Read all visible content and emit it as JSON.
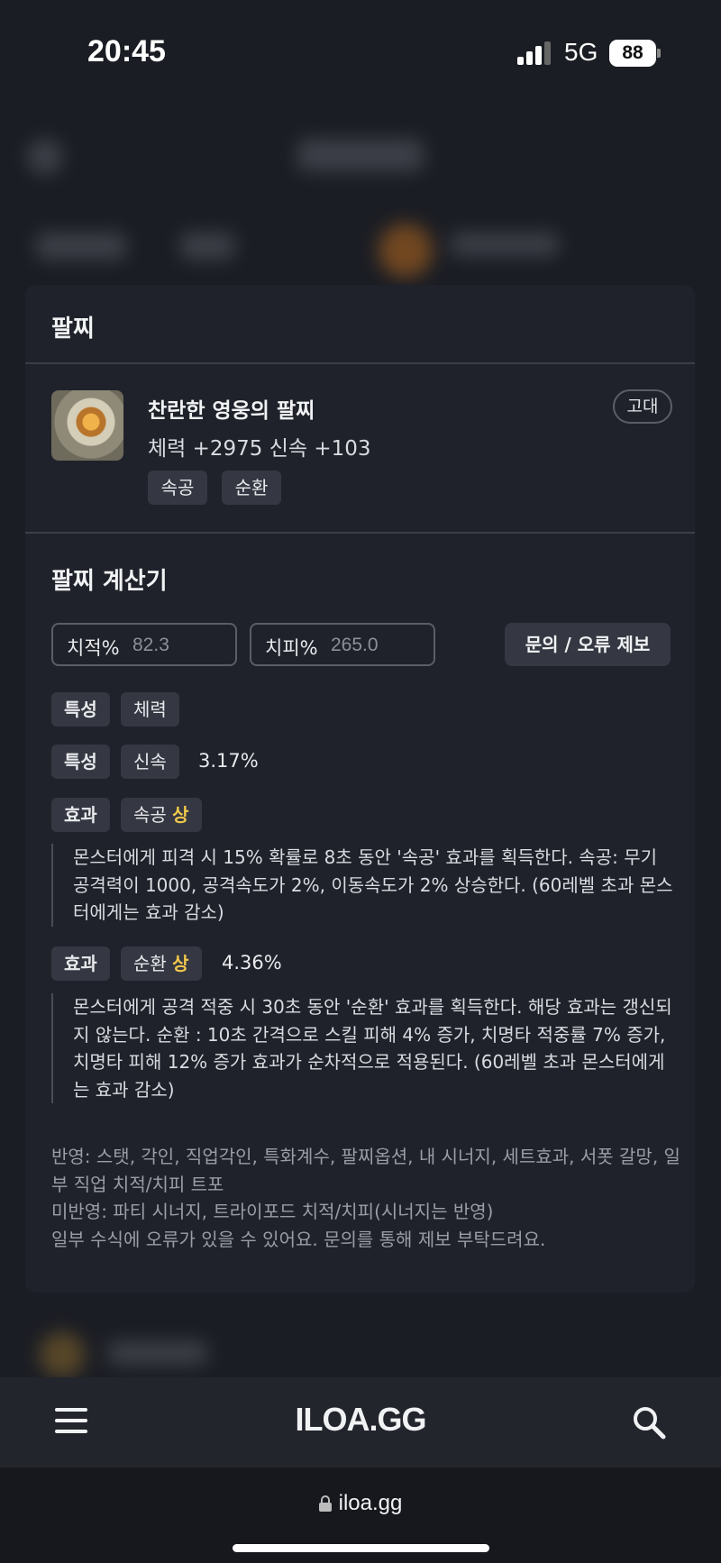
{
  "status_bar": {
    "time": "20:45",
    "network": "5G",
    "battery": "88"
  },
  "modal": {
    "title": "팔찌",
    "item": {
      "name": "찬란한 영웅의 팔찌",
      "stats": "체력 +2975  신속 +103",
      "grade": "고대",
      "tags": [
        "속공",
        "순환"
      ]
    },
    "calculator": {
      "title": "팔찌 계산기",
      "crit_rate": {
        "label": "치적%",
        "placeholder": "82.3"
      },
      "crit_damage": {
        "label": "치피%",
        "placeholder": "265.0"
      },
      "report_button": "문의 / 오류 제보",
      "rows": [
        {
          "kind": "특성",
          "name": "체력",
          "value": ""
        },
        {
          "kind": "특성",
          "name": "신속",
          "value": "3.17%"
        },
        {
          "kind": "효과",
          "name": "속공",
          "grade": "상",
          "value": "",
          "description": "몬스터에게 피격 시 15% 확률로 8초 동안 '속공' 효과를 획득한다. 속공: 무기 공격력이 1000, 공격속도가 2%, 이동속도가 2% 상승한다. (60레벨 초과 몬스터에게는 효과 감소)"
        },
        {
          "kind": "효과",
          "name": "순환",
          "grade": "상",
          "value": "4.36%",
          "description": "몬스터에게 공격 적중 시 30초 동안 '순환' 효과를 획득한다. 해당 효과는 갱신되지 않는다. 순환 : 10초 간격으로 스킬 피해 4% 증가, 치명타 적중률 7% 증가, 치명타 피해 12% 증가 효과가 순차적으로 적용된다. (60레벨 초과 몬스터에게는 효과 감소)"
        }
      ],
      "notes": [
        "반영: 스탯, 각인, 직업각인, 특화계수, 팔찌옵션, 내 시너지, 세트효과, 서폿 갈망, 일부 직업 치적/치피 트포",
        "미반영: 파티 시너지, 트라이포드 치적/치피(시너지는 반영)",
        "일부 수식에 오류가 있을 수 있어요. 문의를 통해 제보 부탁드려요."
      ]
    }
  },
  "navbar": {
    "logo": "ILOA.GG",
    "menu_icon": "hamburger-icon",
    "search_icon": "search-icon"
  },
  "browser": {
    "url": "iloa.gg"
  },
  "colors": {
    "background": "#1b1d24",
    "modal": "#1f222a",
    "chip": "#353842",
    "grade_highlight": "#f2c94c"
  }
}
